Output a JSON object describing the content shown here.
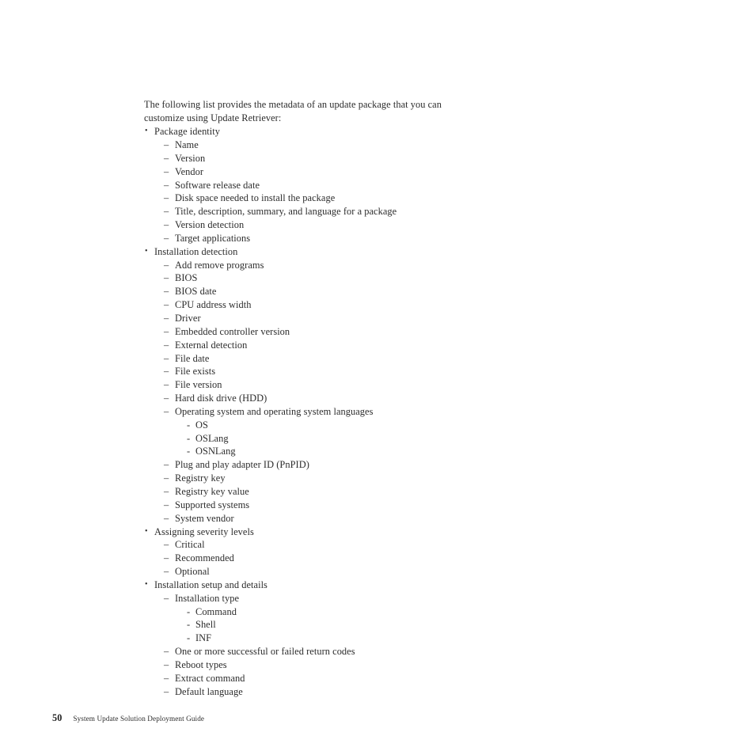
{
  "document": {
    "intro_paragraph": "The following list provides the metadata of an update package that you can customize using Update Retriever:",
    "bullet_glyph": "•",
    "dash_glyph": "–",
    "hyphen_glyph": "-",
    "sections": [
      {
        "label": "Package identity",
        "children": [
          {
            "label": "Name"
          },
          {
            "label": "Version"
          },
          {
            "label": "Vendor"
          },
          {
            "label": "Software release date"
          },
          {
            "label": "Disk space needed to install the package"
          },
          {
            "label": "Title, description, summary, and language for a package"
          },
          {
            "label": "Version detection"
          },
          {
            "label": "Target applications"
          }
        ]
      },
      {
        "label": "Installation detection",
        "children": [
          {
            "label": "Add remove programs"
          },
          {
            "label": "BIOS"
          },
          {
            "label": "BIOS date"
          },
          {
            "label": "CPU address width"
          },
          {
            "label": "Driver"
          },
          {
            "label": "Embedded controller version"
          },
          {
            "label": "External detection"
          },
          {
            "label": "File date"
          },
          {
            "label": "File exists"
          },
          {
            "label": "File version"
          },
          {
            "label": "Hard disk drive (HDD)"
          },
          {
            "label": "Operating system and operating system languages",
            "children": [
              {
                "label": "OS"
              },
              {
                "label": "OSLang"
              },
              {
                "label": "OSNLang"
              }
            ]
          },
          {
            "label": "Plug and play adapter ID (PnPID)"
          },
          {
            "label": "Registry key"
          },
          {
            "label": "Registry key value"
          },
          {
            "label": "Supported systems"
          },
          {
            "label": "System vendor"
          }
        ]
      },
      {
        "label": "Assigning severity levels",
        "children": [
          {
            "label": "Critical"
          },
          {
            "label": "Recommended"
          },
          {
            "label": "Optional"
          }
        ]
      },
      {
        "label": "Installation setup and details",
        "children": [
          {
            "label": "Installation type",
            "children": [
              {
                "label": "Command"
              },
              {
                "label": "Shell"
              },
              {
                "label": "INF"
              }
            ]
          },
          {
            "label": "One or more successful or failed return codes"
          },
          {
            "label": "Reboot types"
          },
          {
            "label": "Extract command"
          },
          {
            "label": "Default language"
          }
        ]
      }
    ]
  },
  "footer": {
    "page_number": "50",
    "book_title": "System Update Solution Deployment Guide"
  }
}
